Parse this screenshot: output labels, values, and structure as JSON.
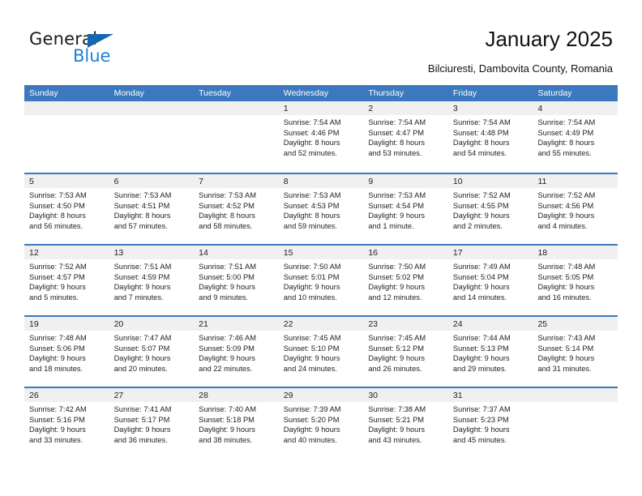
{
  "brand": {
    "name_part1": "General",
    "name_part2": "Blue",
    "triangle_icon": "triangle-icon",
    "accent_color": "#1f7fd4"
  },
  "header": {
    "title": "January 2025",
    "location": "Bilciuresti, Dambovita County, Romania"
  },
  "calendar": {
    "header_color": "#3b78bd",
    "weekday_headers": [
      "Sunday",
      "Monday",
      "Tuesday",
      "Wednesday",
      "Thursday",
      "Friday",
      "Saturday"
    ],
    "weeks": [
      [
        {
          "day": "",
          "sunrise": "",
          "sunset": "",
          "daylight1": "",
          "daylight2": ""
        },
        {
          "day": "",
          "sunrise": "",
          "sunset": "",
          "daylight1": "",
          "daylight2": ""
        },
        {
          "day": "",
          "sunrise": "",
          "sunset": "",
          "daylight1": "",
          "daylight2": ""
        },
        {
          "day": "1",
          "sunrise": "Sunrise: 7:54 AM",
          "sunset": "Sunset: 4:46 PM",
          "daylight1": "Daylight: 8 hours",
          "daylight2": "and 52 minutes."
        },
        {
          "day": "2",
          "sunrise": "Sunrise: 7:54 AM",
          "sunset": "Sunset: 4:47 PM",
          "daylight1": "Daylight: 8 hours",
          "daylight2": "and 53 minutes."
        },
        {
          "day": "3",
          "sunrise": "Sunrise: 7:54 AM",
          "sunset": "Sunset: 4:48 PM",
          "daylight1": "Daylight: 8 hours",
          "daylight2": "and 54 minutes."
        },
        {
          "day": "4",
          "sunrise": "Sunrise: 7:54 AM",
          "sunset": "Sunset: 4:49 PM",
          "daylight1": "Daylight: 8 hours",
          "daylight2": "and 55 minutes."
        }
      ],
      [
        {
          "day": "5",
          "sunrise": "Sunrise: 7:53 AM",
          "sunset": "Sunset: 4:50 PM",
          "daylight1": "Daylight: 8 hours",
          "daylight2": "and 56 minutes."
        },
        {
          "day": "6",
          "sunrise": "Sunrise: 7:53 AM",
          "sunset": "Sunset: 4:51 PM",
          "daylight1": "Daylight: 8 hours",
          "daylight2": "and 57 minutes."
        },
        {
          "day": "7",
          "sunrise": "Sunrise: 7:53 AM",
          "sunset": "Sunset: 4:52 PM",
          "daylight1": "Daylight: 8 hours",
          "daylight2": "and 58 minutes."
        },
        {
          "day": "8",
          "sunrise": "Sunrise: 7:53 AM",
          "sunset": "Sunset: 4:53 PM",
          "daylight1": "Daylight: 8 hours",
          "daylight2": "and 59 minutes."
        },
        {
          "day": "9",
          "sunrise": "Sunrise: 7:53 AM",
          "sunset": "Sunset: 4:54 PM",
          "daylight1": "Daylight: 9 hours",
          "daylight2": "and 1 minute."
        },
        {
          "day": "10",
          "sunrise": "Sunrise: 7:52 AM",
          "sunset": "Sunset: 4:55 PM",
          "daylight1": "Daylight: 9 hours",
          "daylight2": "and 2 minutes."
        },
        {
          "day": "11",
          "sunrise": "Sunrise: 7:52 AM",
          "sunset": "Sunset: 4:56 PM",
          "daylight1": "Daylight: 9 hours",
          "daylight2": "and 4 minutes."
        }
      ],
      [
        {
          "day": "12",
          "sunrise": "Sunrise: 7:52 AM",
          "sunset": "Sunset: 4:57 PM",
          "daylight1": "Daylight: 9 hours",
          "daylight2": "and 5 minutes."
        },
        {
          "day": "13",
          "sunrise": "Sunrise: 7:51 AM",
          "sunset": "Sunset: 4:59 PM",
          "daylight1": "Daylight: 9 hours",
          "daylight2": "and 7 minutes."
        },
        {
          "day": "14",
          "sunrise": "Sunrise: 7:51 AM",
          "sunset": "Sunset: 5:00 PM",
          "daylight1": "Daylight: 9 hours",
          "daylight2": "and 9 minutes."
        },
        {
          "day": "15",
          "sunrise": "Sunrise: 7:50 AM",
          "sunset": "Sunset: 5:01 PM",
          "daylight1": "Daylight: 9 hours",
          "daylight2": "and 10 minutes."
        },
        {
          "day": "16",
          "sunrise": "Sunrise: 7:50 AM",
          "sunset": "Sunset: 5:02 PM",
          "daylight1": "Daylight: 9 hours",
          "daylight2": "and 12 minutes."
        },
        {
          "day": "17",
          "sunrise": "Sunrise: 7:49 AM",
          "sunset": "Sunset: 5:04 PM",
          "daylight1": "Daylight: 9 hours",
          "daylight2": "and 14 minutes."
        },
        {
          "day": "18",
          "sunrise": "Sunrise: 7:48 AM",
          "sunset": "Sunset: 5:05 PM",
          "daylight1": "Daylight: 9 hours",
          "daylight2": "and 16 minutes."
        }
      ],
      [
        {
          "day": "19",
          "sunrise": "Sunrise: 7:48 AM",
          "sunset": "Sunset: 5:06 PM",
          "daylight1": "Daylight: 9 hours",
          "daylight2": "and 18 minutes."
        },
        {
          "day": "20",
          "sunrise": "Sunrise: 7:47 AM",
          "sunset": "Sunset: 5:07 PM",
          "daylight1": "Daylight: 9 hours",
          "daylight2": "and 20 minutes."
        },
        {
          "day": "21",
          "sunrise": "Sunrise: 7:46 AM",
          "sunset": "Sunset: 5:09 PM",
          "daylight1": "Daylight: 9 hours",
          "daylight2": "and 22 minutes."
        },
        {
          "day": "22",
          "sunrise": "Sunrise: 7:45 AM",
          "sunset": "Sunset: 5:10 PM",
          "daylight1": "Daylight: 9 hours",
          "daylight2": "and 24 minutes."
        },
        {
          "day": "23",
          "sunrise": "Sunrise: 7:45 AM",
          "sunset": "Sunset: 5:12 PM",
          "daylight1": "Daylight: 9 hours",
          "daylight2": "and 26 minutes."
        },
        {
          "day": "24",
          "sunrise": "Sunrise: 7:44 AM",
          "sunset": "Sunset: 5:13 PM",
          "daylight1": "Daylight: 9 hours",
          "daylight2": "and 29 minutes."
        },
        {
          "day": "25",
          "sunrise": "Sunrise: 7:43 AM",
          "sunset": "Sunset: 5:14 PM",
          "daylight1": "Daylight: 9 hours",
          "daylight2": "and 31 minutes."
        }
      ],
      [
        {
          "day": "26",
          "sunrise": "Sunrise: 7:42 AM",
          "sunset": "Sunset: 5:16 PM",
          "daylight1": "Daylight: 9 hours",
          "daylight2": "and 33 minutes."
        },
        {
          "day": "27",
          "sunrise": "Sunrise: 7:41 AM",
          "sunset": "Sunset: 5:17 PM",
          "daylight1": "Daylight: 9 hours",
          "daylight2": "and 36 minutes."
        },
        {
          "day": "28",
          "sunrise": "Sunrise: 7:40 AM",
          "sunset": "Sunset: 5:18 PM",
          "daylight1": "Daylight: 9 hours",
          "daylight2": "and 38 minutes."
        },
        {
          "day": "29",
          "sunrise": "Sunrise: 7:39 AM",
          "sunset": "Sunset: 5:20 PM",
          "daylight1": "Daylight: 9 hours",
          "daylight2": "and 40 minutes."
        },
        {
          "day": "30",
          "sunrise": "Sunrise: 7:38 AM",
          "sunset": "Sunset: 5:21 PM",
          "daylight1": "Daylight: 9 hours",
          "daylight2": "and 43 minutes."
        },
        {
          "day": "31",
          "sunrise": "Sunrise: 7:37 AM",
          "sunset": "Sunset: 5:23 PM",
          "daylight1": "Daylight: 9 hours",
          "daylight2": "and 45 minutes."
        },
        {
          "day": "",
          "sunrise": "",
          "sunset": "",
          "daylight1": "",
          "daylight2": ""
        }
      ]
    ]
  }
}
